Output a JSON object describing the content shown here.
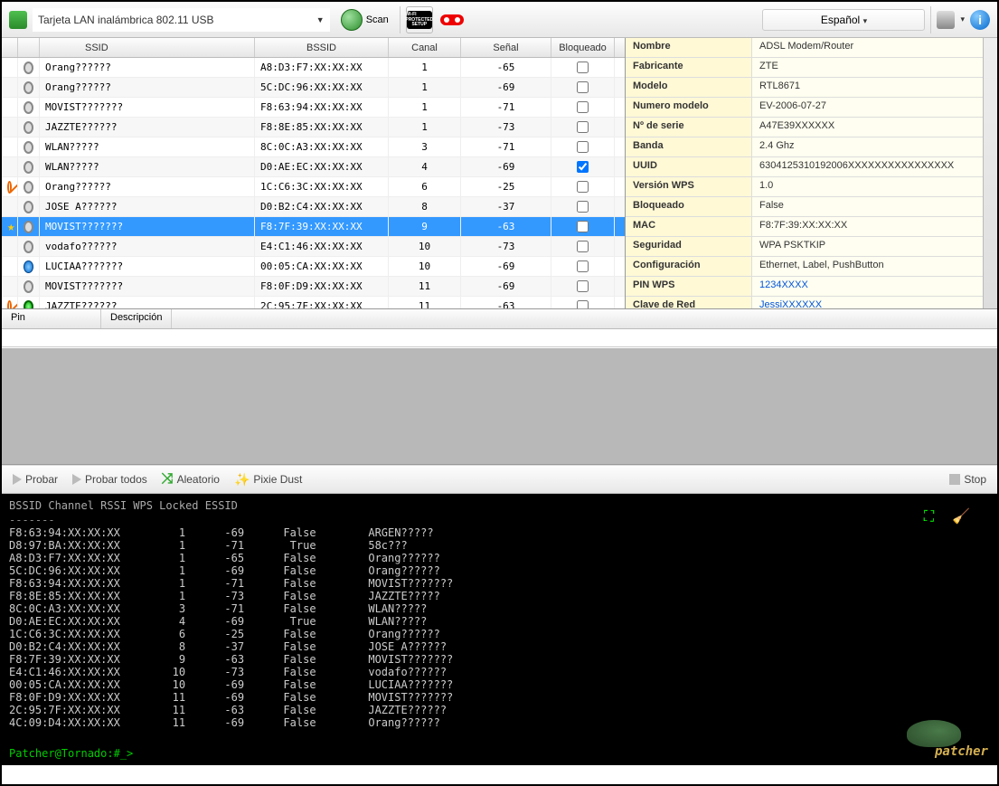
{
  "toolbar": {
    "adapter": "Tarjeta LAN inalámbrica 802.11 USB",
    "scan": "Scan",
    "language": "Español"
  },
  "grid": {
    "headers": {
      "ssid": "SSID",
      "bssid": "BSSID",
      "canal": "Canal",
      "senal": "Señal",
      "bloqueado": "Bloqueado"
    },
    "rows": [
      {
        "ssid": "Orang??????",
        "bssid": "A8:D3:F7:XX:XX:XX",
        "canal": "1",
        "senal": "-65",
        "locked": false
      },
      {
        "ssid": "Orang??????",
        "bssid": "5C:DC:96:XX:XX:XX",
        "canal": "1",
        "senal": "-69",
        "locked": false
      },
      {
        "ssid": "MOVIST???????",
        "bssid": "F8:63:94:XX:XX:XX",
        "canal": "1",
        "senal": "-71",
        "locked": false
      },
      {
        "ssid": "JAZZTE??????",
        "bssid": "F8:8E:85:XX:XX:XX",
        "canal": "1",
        "senal": "-73",
        "locked": false
      },
      {
        "ssid": "WLAN?????",
        "bssid": "8C:0C:A3:XX:XX:XX",
        "canal": "3",
        "senal": "-71",
        "locked": false
      },
      {
        "ssid": "WLAN?????",
        "bssid": "D0:AE:EC:XX:XX:XX",
        "canal": "4",
        "senal": "-69",
        "locked": true
      },
      {
        "ssid": "Orang??????",
        "bssid": "1C:C6:3C:XX:XX:XX",
        "canal": "6",
        "senal": "-25",
        "locked": false,
        "i0": "no"
      },
      {
        "ssid": "JOSE A??????",
        "bssid": "D0:B2:C4:XX:XX:XX",
        "canal": "8",
        "senal": "-37",
        "locked": false
      },
      {
        "ssid": "MOVIST???????",
        "bssid": "F8:7F:39:XX:XX:XX",
        "canal": "9",
        "senal": "-63",
        "locked": false,
        "sel": true,
        "i0": "star"
      },
      {
        "ssid": "vodafo??????",
        "bssid": "E4:C1:46:XX:XX:XX",
        "canal": "10",
        "senal": "-73",
        "locked": false
      },
      {
        "ssid": "LUCIAA???????",
        "bssid": "00:05:CA:XX:XX:XX",
        "canal": "10",
        "senal": "-69",
        "locked": false,
        "i1": "globe"
      },
      {
        "ssid": "MOVIST???????",
        "bssid": "F8:0F:D9:XX:XX:XX",
        "canal": "11",
        "senal": "-69",
        "locked": false
      },
      {
        "ssid": "JAZZTE??????",
        "bssid": "2C:95:7F:XX:XX:XX",
        "canal": "11",
        "senal": "-63",
        "locked": false,
        "i0": "no",
        "i1": "grn"
      }
    ]
  },
  "props": [
    {
      "k": "Nombre",
      "v": "ADSL Modem/Router"
    },
    {
      "k": "Fabricante",
      "v": "ZTE"
    },
    {
      "k": "Modelo",
      "v": "RTL8671"
    },
    {
      "k": "Numero modelo",
      "v": "EV-2006-07-27"
    },
    {
      "k": "Nº de serie",
      "v": "A47E39XXXXXX"
    },
    {
      "k": "Banda",
      "v": "2.4 Ghz"
    },
    {
      "k": "UUID",
      "v": "6304125310192006XXXXXXXXXXXXXXXX"
    },
    {
      "k": "Versión WPS",
      "v": "1.0"
    },
    {
      "k": "Bloqueado",
      "v": "False"
    },
    {
      "k": "MAC",
      "v": "F8:7F:39:XX:XX:XX"
    },
    {
      "k": "Seguridad",
      "v": "WPA PSKTKIP"
    },
    {
      "k": "Configuración",
      "v": "Ethernet, Label, PushButton"
    },
    {
      "k": "PIN WPS",
      "v": "1234XXXX",
      "link": true
    },
    {
      "k": "Clave de Red",
      "v": "JessiXXXXXX",
      "link": true
    }
  ],
  "pin": {
    "pin": "Pin",
    "desc": "Descripción"
  },
  "toolbar2": {
    "probar": "Probar",
    "todos": "Probar todos",
    "aleatorio": "Aleatorio",
    "pixie": "Pixie Dust",
    "stop": "Stop"
  },
  "term": {
    "header": "BSSID               Channel     RSSI    WPS Locked     ESSID",
    "rows": [
      "F8:63:94:XX:XX:XX         1      -69      False        ARGEN?????",
      "D8:97:BA:XX:XX:XX         1      -71       True        58c???",
      "A8:D3:F7:XX:XX:XX         1      -65      False        Orang??????",
      "5C:DC:96:XX:XX:XX         1      -69      False        Orang??????",
      "F8:63:94:XX:XX:XX         1      -71      False        MOVIST???????",
      "F8:8E:85:XX:XX:XX         1      -73      False        JAZZTE?????",
      "8C:0C:A3:XX:XX:XX         3      -71      False        WLAN?????",
      "D0:AE:EC:XX:XX:XX         4      -69       True        WLAN?????",
      "1C:C6:3C:XX:XX:XX         6      -25      False        Orang??????",
      "D0:B2:C4:XX:XX:XX         8      -37      False        JOSE A??????",
      "F8:7F:39:XX:XX:XX         9      -63      False        MOVIST???????",
      "E4:C1:46:XX:XX:XX        10      -73      False        vodafo??????",
      "00:05:CA:XX:XX:XX        10      -69      False        LUCIAA???????",
      "F8:0F:D9:XX:XX:XX        11      -69      False        MOVIST???????",
      "2C:95:7F:XX:XX:XX        11      -63      False        JAZZTE??????",
      "4C:09:D4:XX:XX:XX        11      -69      False        Orang??????"
    ],
    "prompt": "Patcher@Tornado:#_>",
    "logo": "patcher"
  }
}
